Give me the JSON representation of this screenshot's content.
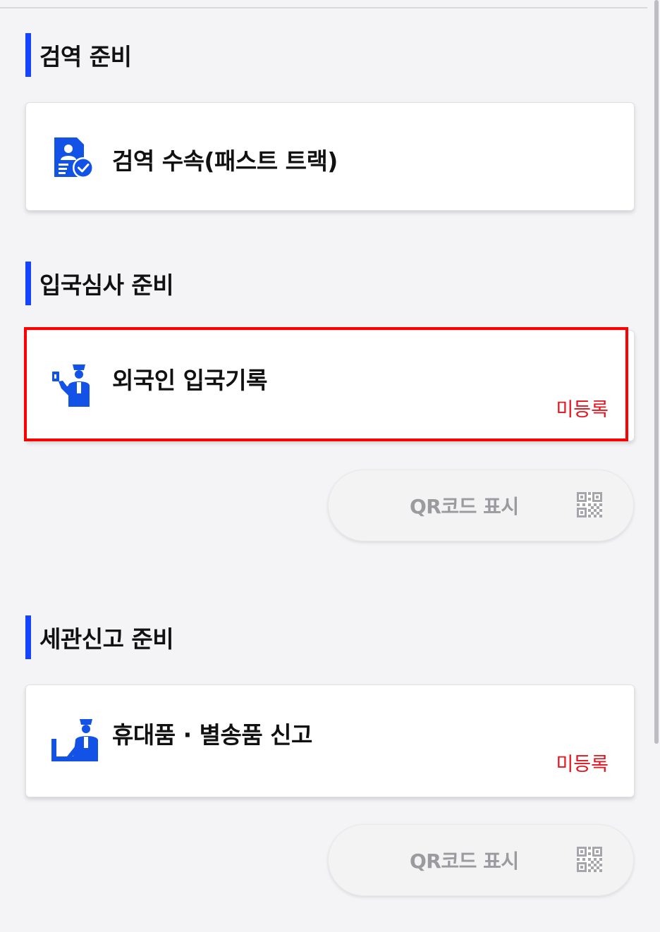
{
  "colors": {
    "accent": "#1544ff",
    "icon_blue": "#1352e6",
    "status_red": "#e8101a",
    "highlight": "#ff0000",
    "disabled_text": "#9b9b9f"
  },
  "sections": [
    {
      "title": "검역 준비",
      "card": {
        "label": "검역 수속(패스트 트랙)",
        "icon": "health-document-check-icon"
      }
    },
    {
      "title": "입국심사 준비",
      "card": {
        "label": "외국인 입국기록",
        "status": "미등록",
        "icon": "immigration-officer-passport-icon"
      },
      "qr_button": {
        "label": "QR코드 표시",
        "icon": "qr-code-icon"
      }
    },
    {
      "title": "세관신고 준비",
      "card": {
        "label": "휴대품 · 별송품 신고",
        "status": "미등록",
        "icon": "customs-officer-desk-icon"
      },
      "qr_button": {
        "label": "QR코드 표시",
        "icon": "qr-code-icon"
      }
    }
  ]
}
